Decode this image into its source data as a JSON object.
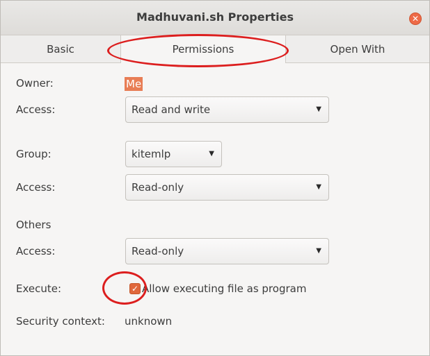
{
  "window": {
    "title": "Madhuvani.sh Properties",
    "close_icon": "close-icon"
  },
  "tabs": [
    {
      "label": "Basic"
    },
    {
      "label": "Permissions"
    },
    {
      "label": "Open With"
    }
  ],
  "owner": {
    "label": "Owner:",
    "value": "Me"
  },
  "owner_access": {
    "label": "Access:",
    "value": "Read and write"
  },
  "group": {
    "label": "Group:",
    "value": "kitemlp"
  },
  "group_access": {
    "label": "Access:",
    "value": "Read-only"
  },
  "others": {
    "label": "Others"
  },
  "others_access": {
    "label": "Access:",
    "value": "Read-only"
  },
  "execute": {
    "label": "Execute:",
    "checked": true,
    "checkbox_label": "Allow executing file as program"
  },
  "security": {
    "label": "Security context:",
    "value": "unknown"
  },
  "colors": {
    "accent": "#e87d55",
    "annotation": "#dc1e1e"
  },
  "icons": {
    "dropdown": "chevron-down-icon",
    "close": "close-icon",
    "check": "check-icon"
  }
}
